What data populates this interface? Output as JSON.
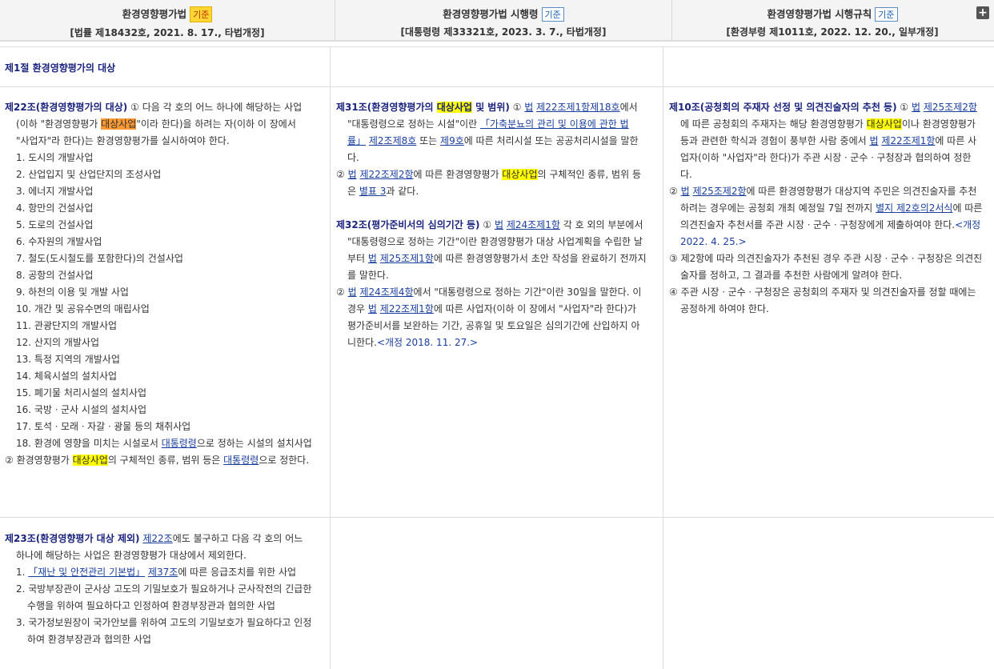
{
  "header": {
    "col1": {
      "title": "환경영향평가법",
      "badge": "기준",
      "sub": "[법률 제18432호, 2021. 8. 17., 타법개정]"
    },
    "col2": {
      "title": "환경영향평가법 시행령",
      "badge": "기준",
      "sub": "[대통령령 제33321호, 2023. 3. 7., 타법개정]"
    },
    "col3": {
      "title": "환경영향평가법 시행규칙",
      "badge": "기준",
      "sub": "[환경부령 제1011호, 2022. 12. 20., 일부개정]"
    },
    "expand": "+"
  },
  "section": {
    "title": "제1절 환경영향평가의 대상"
  },
  "art22": {
    "head": "제22조(환경영향평가의 대상)",
    "p1a": "① 다음 각 호의 어느 하나에 해당하는 사업(이하 \"환경영향평가 ",
    "hl": "대상사업",
    "p1b": "\"이라 한다)을 하려는 자(이하 이 장에서 \"사업자\"라 한다)는 환경영향평가를 실시하여야 한다.",
    "items": [
      "1. 도시의 개발사업",
      "2. 산업입지 및 산업단지의 조성사업",
      "3. 에너지 개발사업",
      "4. 항만의 건설사업",
      "5. 도로의 건설사업",
      "6. 수자원의 개발사업",
      "7. 철도(도시철도를 포함한다)의 건설사업",
      "8. 공항의 건설사업",
      "9. 하천의 이용 및 개발 사업",
      "10. 개간 및 공유수면의 매립사업",
      "11. 관광단지의 개발사업",
      "12. 산지의 개발사업",
      "13. 특정 지역의 개발사업",
      "14. 체육시설의 설치사업",
      "15. 폐기물 처리시설의 설치사업",
      "16. 국방ㆍ군사 시설의 설치사업",
      "17. 토석ㆍ모래ㆍ자갈ㆍ광물 등의 채취사업"
    ],
    "i18a": "18. 환경에 영향을 미치는 시설로서 ",
    "i18link": "대통령령",
    "i18b": "으로 정하는 시설의 설치사업",
    "p2a": "② 환경영향평가 ",
    "p2hl": "대상사업",
    "p2b": "의 구체적인 종류, 범위 등은 ",
    "p2link": "대통령령",
    "p2c": "으로 정한다."
  },
  "art23": {
    "head": "제23조(환경영향평가 대상 제외)",
    "ref": "제22조",
    "p1": "에도 불구하고 다음 각 호의 어느 하나에 해당하는 사업은 환경영향평가 대상에서 제외한다.",
    "i1link": "「재난 및 안전관리 기본법」",
    "i1ref": "제37조",
    "i1b": "에 따른 응급조치를 위한 사업",
    "i1num": "1.",
    "i2": "2. 국방부장관이 군사상 고도의 기밀보호가 필요하거나 군사작전의 긴급한 수행을 위하여 필요하다고 인정하여 환경부장관과 협의한 사업",
    "i3": "3. 국가정보원장이 국가안보를 위하여 고도의 기밀보호가 필요하다고 인정하여 환경부장관과 협의한 사업"
  },
  "art31": {
    "head1": "제31조(환경영향평가의 ",
    "headhl": "대상사업",
    "head2": " 및 범위)",
    "p1a": "① ",
    "p1law": "법",
    "p1ref": "제22조제1항제18호",
    "p1b": "에서 \"대통령령으로 정하는 시설\"이란 ",
    "p1link": "「가축분뇨의 관리 및 이용에 관한 법률」",
    "p1ref2": "제2조제8호",
    "p1c": " 또는 ",
    "p1ref3": "제9호",
    "p1d": "에 따른 처리시설 또는 공공처리시설을 말한다.",
    "p2a": "② ",
    "p2law": "법",
    "p2ref": "제22조제2항",
    "p2b": "에 따른 환경영향평가 ",
    "p2hl": "대상사업",
    "p2c": "의 구체적인 종류, 범위 등은 ",
    "p2link": "별표 3",
    "p2d": "과 같다."
  },
  "art32": {
    "head": "제32조(평가준비서의 심의기간 등)",
    "p1a": "① ",
    "p1law": "법",
    "p1ref": "제24조제1항",
    "p1b": " 각 호 외의 부분에서 \"대통령령으로 정하는 기간\"이란 환경영향평가 대상 사업계획을 수립한 날부터 ",
    "p1law2": "법",
    "p1ref2": "제25조제1항",
    "p1c": "에 따른 환경영향평가서 초안 작성을 완료하기 전까지를 말한다.",
    "p2a": "② ",
    "p2law": "법",
    "p2ref": "제24조제4항",
    "p2b": "에서 \"대통령령으로 정하는 기간\"이란 30일을 말한다. 이 경우 ",
    "p2law2": "법",
    "p2ref2": "제22조제1항",
    "p2c": "에 따른 사업자(이하 이 장에서 \"사업자\"라 한다)가 평가준비서를 보완하는 기간, 공휴일 및 토요일은 심의기간에 산입하지 아니한다.",
    "amend": "<개정 2018. 11. 27.>"
  },
  "rule10": {
    "head": "제10조(공청회의 주재자 선정 및 의견진술자의 추천 등)",
    "p1a": "① ",
    "p1law": "법",
    "p1ref": "제25조제2항",
    "p1b": "에 따른 공청회의 주재자는 해당 환경영향평가 ",
    "p1hl": "대상사업",
    "p1c": "이나 환경영향평가등과 관련한 학식과 경험이 풍부한 사람 중에서 ",
    "p1law2": "법",
    "p1ref2": "제22조제1항",
    "p1d": "에 따른 사업자(이하 \"사업자\"라 한다)가 주관 시장ㆍ군수ㆍ구청장과 협의하여 정한다.",
    "p2a": "② ",
    "p2law": "법",
    "p2ref": "제25조제2항",
    "p2b": "에 따른 환경영향평가 대상지역 주민은 의견진술자를 추천하려는 경우에는 공청회 개최 예정일 7일 전까지 ",
    "p2link": "별지 제2호의2서식",
    "p2c": "에 따른 의견진술자 추천서를 주관 시장ㆍ군수ㆍ구청장에게 제출하여야 한다.",
    "p2amend": "<개정 2022. 4. 25.>",
    "p3": "③ 제2항에 따라 의견진술자가 추천된 경우 주관 시장ㆍ군수ㆍ구청장은 의견진술자를 정하고, 그 결과를 추천한 사람에게 알려야 한다.",
    "p4": "④ 주관 시장ㆍ군수ㆍ구청장은 공청회의 주재자 및 의견진술자를 정할 때에는 공정하게 하여야 한다."
  }
}
